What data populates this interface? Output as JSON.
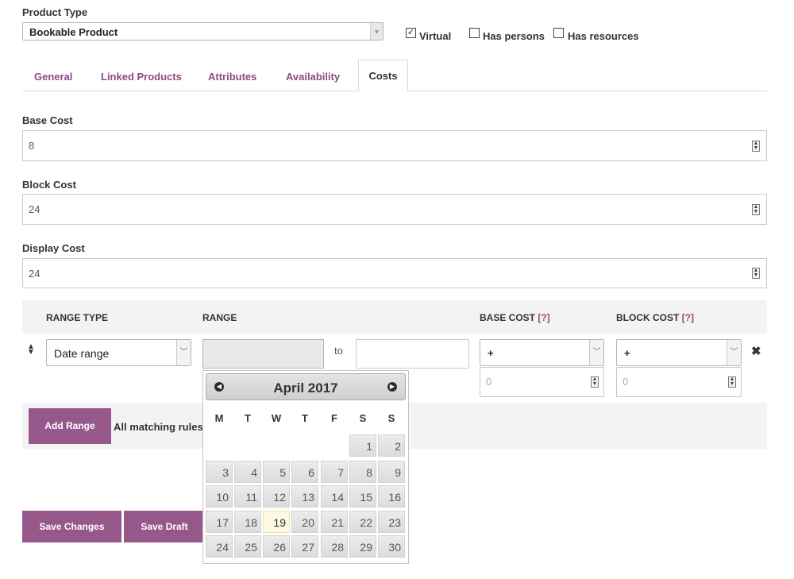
{
  "product_type": {
    "label": "Product Type",
    "value": "Bookable Product",
    "checkboxes": [
      {
        "label": "Virtual",
        "checked": true
      },
      {
        "label": "Has persons",
        "checked": false
      },
      {
        "label": "Has resources",
        "checked": false
      }
    ]
  },
  "tabs": [
    "General",
    "Linked Products",
    "Attributes",
    "Availability",
    "Costs"
  ],
  "active_tab": "Costs",
  "fields": {
    "base_cost": {
      "label": "Base Cost",
      "value": "8"
    },
    "block_cost": {
      "label": "Block Cost",
      "value": "24"
    },
    "display_cost": {
      "label": "Display Cost",
      "value": "24"
    }
  },
  "ranges_table": {
    "headers": {
      "range_type": "RANGE TYPE",
      "range": "RANGE",
      "base_cost": "BASE COST",
      "block_cost": "BLOCK COST",
      "help": "[?]"
    },
    "row": {
      "range_type": "Date range",
      "to_label": "to",
      "base_modifier": "+",
      "base_placeholder": "0",
      "block_modifier": "+",
      "block_placeholder": "0"
    },
    "add_range_label": "Add Range",
    "matching_text": "All matching rules"
  },
  "buttons": {
    "save_changes": "Save Changes",
    "save_draft": "Save Draft"
  },
  "datepicker": {
    "month_year": "April 2017",
    "day_headers": [
      "M",
      "T",
      "W",
      "T",
      "F",
      "S",
      "S"
    ],
    "first_weekday_index": 5,
    "days_in_month": 30,
    "today": 19
  },
  "colors": {
    "accent": "#96588a",
    "tab_link": "#8a4a86"
  }
}
